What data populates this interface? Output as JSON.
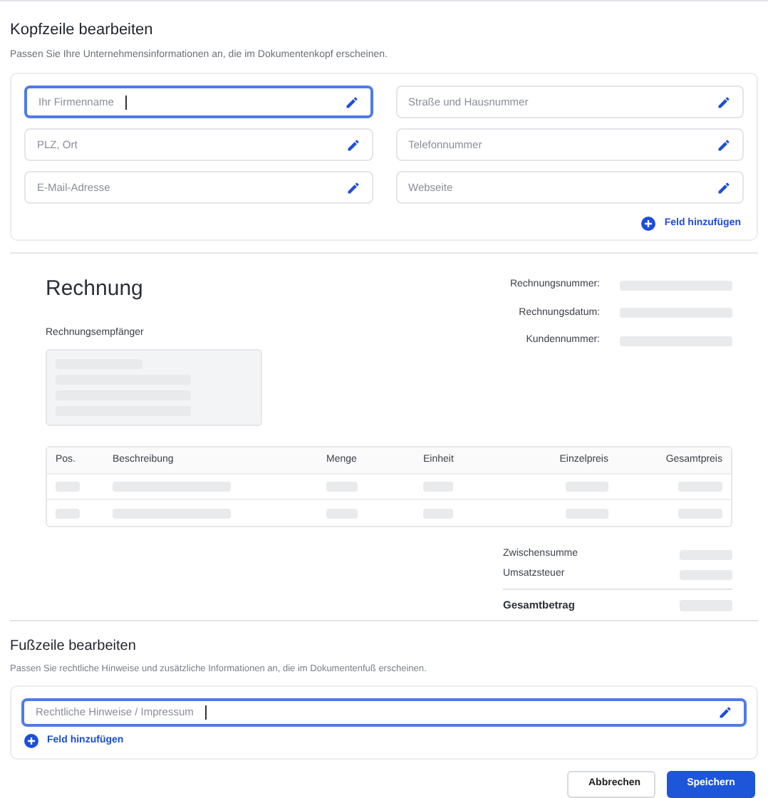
{
  "header": {
    "title": "Kopfzeile bearbeiten",
    "subtitle": "Passen Sie Ihre Unternehmensinformationen an, die im Dokumentenkopf erscheinen.",
    "fields": [
      {
        "placeholder": "Ihr Firmenname",
        "selected": true
      },
      {
        "placeholder": "Straße und Hausnummer",
        "selected": false
      },
      {
        "placeholder": "PLZ, Ort",
        "selected": false
      },
      {
        "placeholder": "Telefonnummer",
        "selected": false
      },
      {
        "placeholder": "E-Mail-Adresse",
        "selected": false
      },
      {
        "placeholder": "Webseite",
        "selected": false
      }
    ],
    "add_field": "Feld hinzufügen"
  },
  "preview": {
    "title": "Rechnung",
    "recipient_label": "Rechnungsempfänger",
    "meta_labels": [
      "Rechnungsnummer:",
      "Rechnungsdatum:",
      "Kundennummer:"
    ],
    "table": {
      "columns": [
        "Pos.",
        "Beschreibung",
        "Menge",
        "Einheit",
        "Einzelpreis",
        "Gesamtpreis"
      ]
    },
    "totals": [
      {
        "label": "Zwischensumme",
        "kind": "normal"
      },
      {
        "label": "Umsatzsteuer",
        "kind": "normal"
      },
      {
        "label": "Gesamtbetrag",
        "kind": "total"
      }
    ]
  },
  "footer": {
    "title": "Fußzeile bearbeiten",
    "subtitle": "Passen Sie rechtliche Hinweise und zusätzliche Informationen an, die im Dokumentenfuß erscheinen.",
    "fields": [
      {
        "placeholder": "Rechtliche Hinweise / Impressum",
        "selected": true
      }
    ],
    "add_field": "Feld hinzufügen"
  },
  "buttons": [
    {
      "label": "Abbrechen",
      "kind": "secondary"
    },
    {
      "label": "Speichern",
      "kind": "primary"
    }
  ]
}
